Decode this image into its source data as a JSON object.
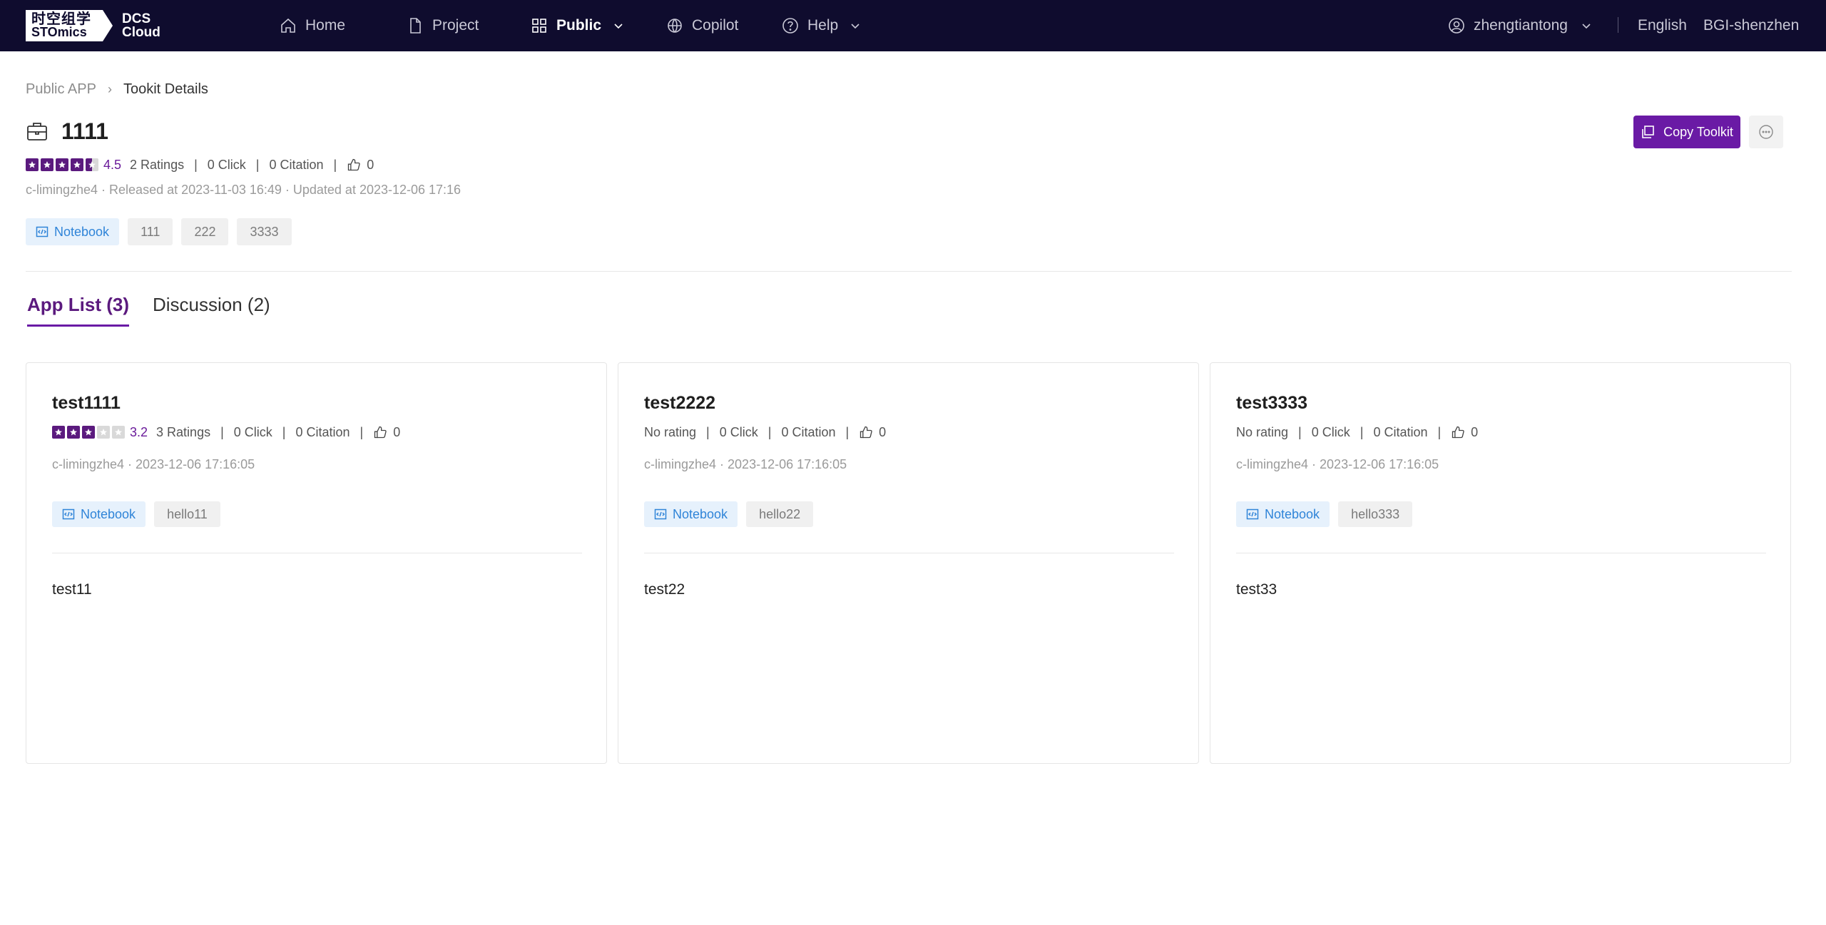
{
  "nav": {
    "logo_cn": "时空组学",
    "logo_en": "STOmics",
    "logo_dcs": "DCS",
    "logo_cloud": "Cloud",
    "items": [
      {
        "label": "Home",
        "icon": "home-icon"
      },
      {
        "label": "Project",
        "icon": "file-icon"
      },
      {
        "label": "Public",
        "icon": "grid-icon",
        "active": true,
        "has_dropdown": true
      },
      {
        "label": "Copilot",
        "icon": "globe-icon"
      },
      {
        "label": "Help",
        "icon": "help-circle-icon",
        "has_dropdown": true
      }
    ],
    "user": "zhengtiantong",
    "language": "English",
    "region": "BGI-shenzhen"
  },
  "breadcrumb": {
    "parent": "Public APP",
    "current": "Tookit Details"
  },
  "toolkit": {
    "title": "1111",
    "rating": 4.5,
    "score": "4.5",
    "ratings": "2 Ratings",
    "clicks": "0 Click",
    "citations": "0 Citation",
    "likes": "0",
    "meta": "c-limingzhe4 · Released at 2023-11-03 16:49 · Updated at 2023-12-06 17:16",
    "tags": [
      "Notebook",
      "111",
      "222",
      "3333"
    ],
    "copy_label": "Copy Toolkit"
  },
  "tabs": [
    {
      "label": "App List (3)",
      "active": true
    },
    {
      "label": "Discussion (2)",
      "active": false
    }
  ],
  "apps": [
    {
      "name": "test1111",
      "rating": 3.2,
      "score": "3.2",
      "ratings": "3 Ratings",
      "clicks": "0 Click",
      "citations": "0 Citation",
      "likes": "0",
      "meta": "c-limingzhe4 · 2023-12-06 17:16:05",
      "tags": [
        "Notebook",
        "hello11"
      ],
      "description": "test11"
    },
    {
      "name": "test2222",
      "ratings": "No rating",
      "clicks": "0 Click",
      "citations": "0 Citation",
      "likes": "0",
      "meta": "c-limingzhe4 · 2023-12-06 17:16:05",
      "tags": [
        "Notebook",
        "hello22"
      ],
      "description": "test22"
    },
    {
      "name": "test3333",
      "ratings": "No rating",
      "clicks": "0 Click",
      "citations": "0 Citation",
      "likes": "0",
      "meta": "c-limingzhe4 · 2023-12-06 17:16:05",
      "tags": [
        "Notebook",
        "hello333"
      ],
      "description": "test33"
    }
  ],
  "colors": {
    "nav_bg": "#0f0c2e",
    "accent": "#6a1aa5",
    "star": "#5b1a7e",
    "tag_blue": "#2f84d8"
  }
}
